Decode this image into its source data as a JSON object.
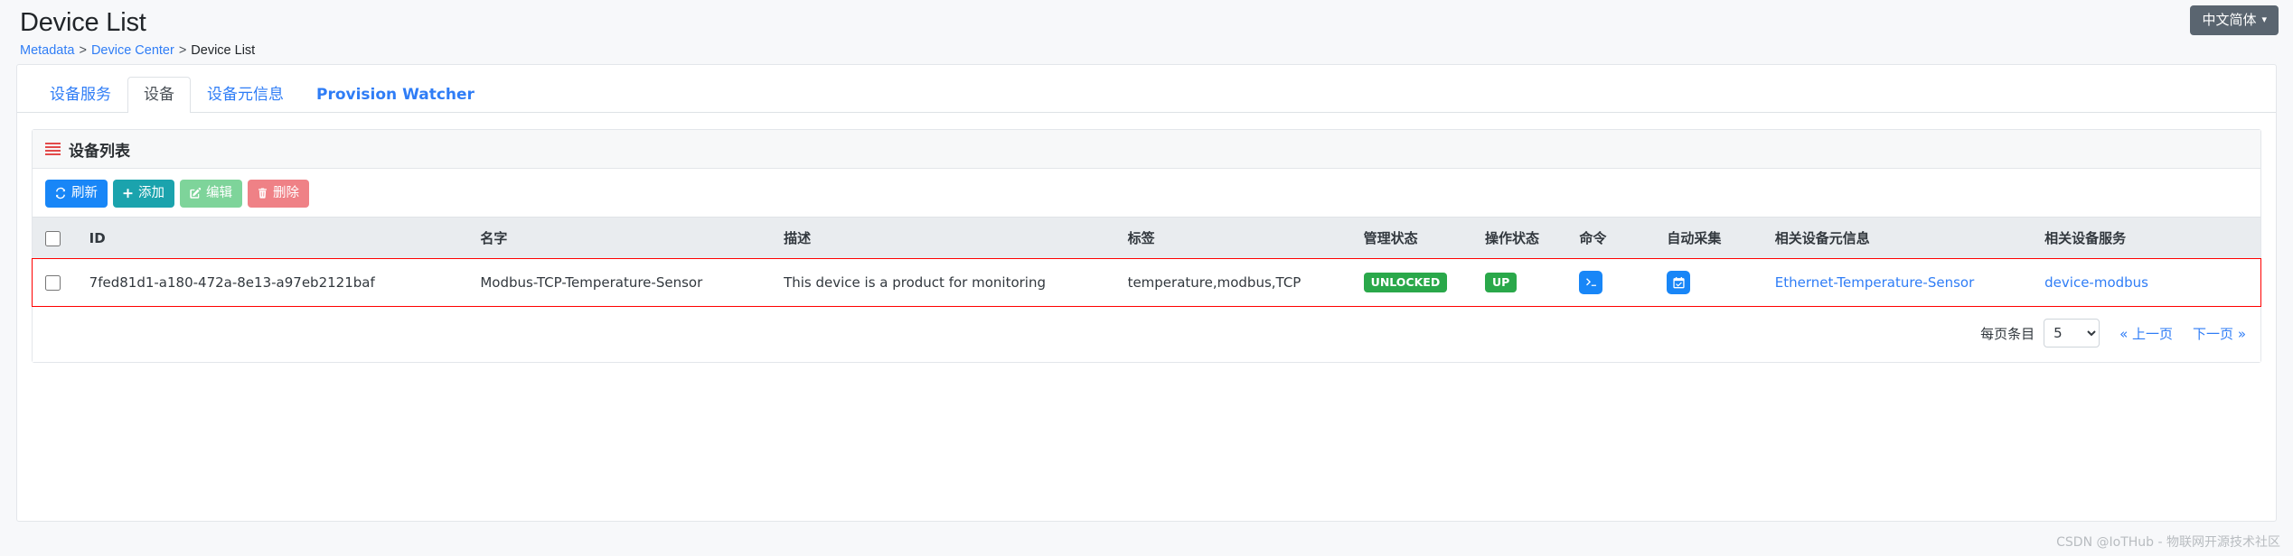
{
  "header": {
    "title": "Device List",
    "breadcrumb": [
      {
        "label": "Metadata",
        "link": true
      },
      {
        "label": "Device Center",
        "link": true
      },
      {
        "label": "Device List",
        "link": false
      }
    ],
    "separator": ">",
    "language_button": "中文简体",
    "language_caret": "▾"
  },
  "tabs": [
    {
      "label": "设备服务",
      "active": false
    },
    {
      "label": "设备",
      "active": true
    },
    {
      "label": "设备元信息",
      "active": false
    },
    {
      "label": "Provision Watcher",
      "active": false
    }
  ],
  "card": {
    "title": "设备列表",
    "icon": "list-icon"
  },
  "toolbar": {
    "refresh_label": "刷新",
    "add_label": "添加",
    "edit_label": "编辑",
    "delete_label": "删除"
  },
  "table": {
    "columns": [
      "ID",
      "名字",
      "描述",
      "标签",
      "管理状态",
      "操作状态",
      "命令",
      "自动采集",
      "相关设备元信息",
      "相关设备服务"
    ],
    "rows": [
      {
        "id": "7fed81d1-a180-472a-8e13-a97eb2121baf",
        "name": "Modbus-TCP-Temperature-Sensor",
        "description": "This device is a product for monitoring",
        "labels": "temperature,modbus,TCP",
        "admin_state": "UNLOCKED",
        "operating_state": "UP",
        "command_icon": "terminal-icon",
        "autoevent_icon": "calendar-check-icon",
        "profile": "Ethernet-Temperature-Sensor",
        "service": "device-modbus"
      }
    ]
  },
  "pagination": {
    "page_size_label": "每页条目",
    "page_size_value": "5",
    "page_size_options": [
      "5"
    ],
    "prev_label": "« 上一页",
    "next_label": "下一页 »"
  },
  "footer": {
    "watermark": "CSDN @IoTHub - 物联网开源技术社区"
  },
  "colors": {
    "primary": "#1886f7",
    "link": "#2f7df6",
    "success": "#2aa84a",
    "add": "#1ba3ad",
    "edit": "#7ed49a",
    "delete": "#ef8186",
    "highlight_outline": "#ff0000",
    "lang_button": "#5a6570"
  }
}
